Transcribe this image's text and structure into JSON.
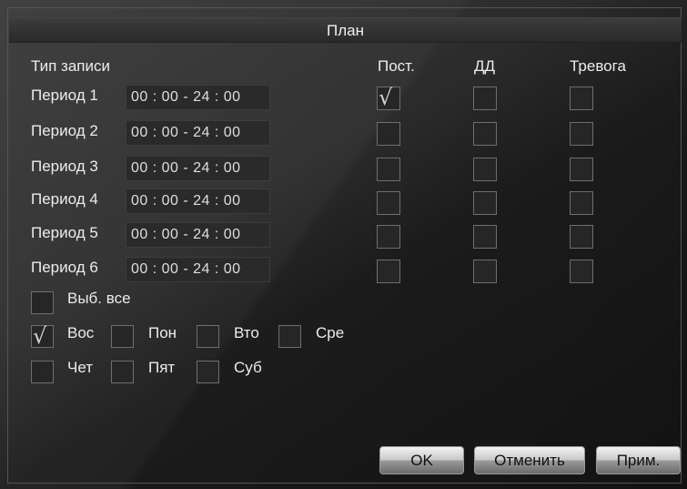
{
  "dialog": {
    "title": "План"
  },
  "header": {
    "record_type_label": "Тип записи",
    "col_constant": "Пост.",
    "col_motion": "ДД",
    "col_alarm": "Тревога"
  },
  "periods": [
    {
      "label": "Период 1",
      "time": "00 : 00 - 24 : 00",
      "constant": true,
      "motion": false,
      "alarm": false
    },
    {
      "label": "Период 2",
      "time": "00 : 00 - 24 : 00",
      "constant": false,
      "motion": false,
      "alarm": false
    },
    {
      "label": "Период 3",
      "time": "00 : 00 - 24 : 00",
      "constant": false,
      "motion": false,
      "alarm": false
    },
    {
      "label": "Период 4",
      "time": "00 : 00 - 24 : 00",
      "constant": false,
      "motion": false,
      "alarm": false
    },
    {
      "label": "Период 5",
      "time": "00 : 00 - 24 : 00",
      "constant": false,
      "motion": false,
      "alarm": false
    },
    {
      "label": "Период 6",
      "time": "00 : 00 - 24 : 00",
      "constant": false,
      "motion": false,
      "alarm": false
    }
  ],
  "select_all": {
    "label": "Выб. все",
    "checked": false
  },
  "days": [
    {
      "label": "Вос",
      "checked": true
    },
    {
      "label": "Пон",
      "checked": false
    },
    {
      "label": "Вто",
      "checked": false
    },
    {
      "label": "Сре",
      "checked": false
    },
    {
      "label": "Чет",
      "checked": false
    },
    {
      "label": "Пят",
      "checked": false
    },
    {
      "label": "Суб",
      "checked": false
    }
  ],
  "check_glyph": "√",
  "buttons": {
    "ok": "OK",
    "cancel": "Отменить",
    "apply": "Прим."
  }
}
